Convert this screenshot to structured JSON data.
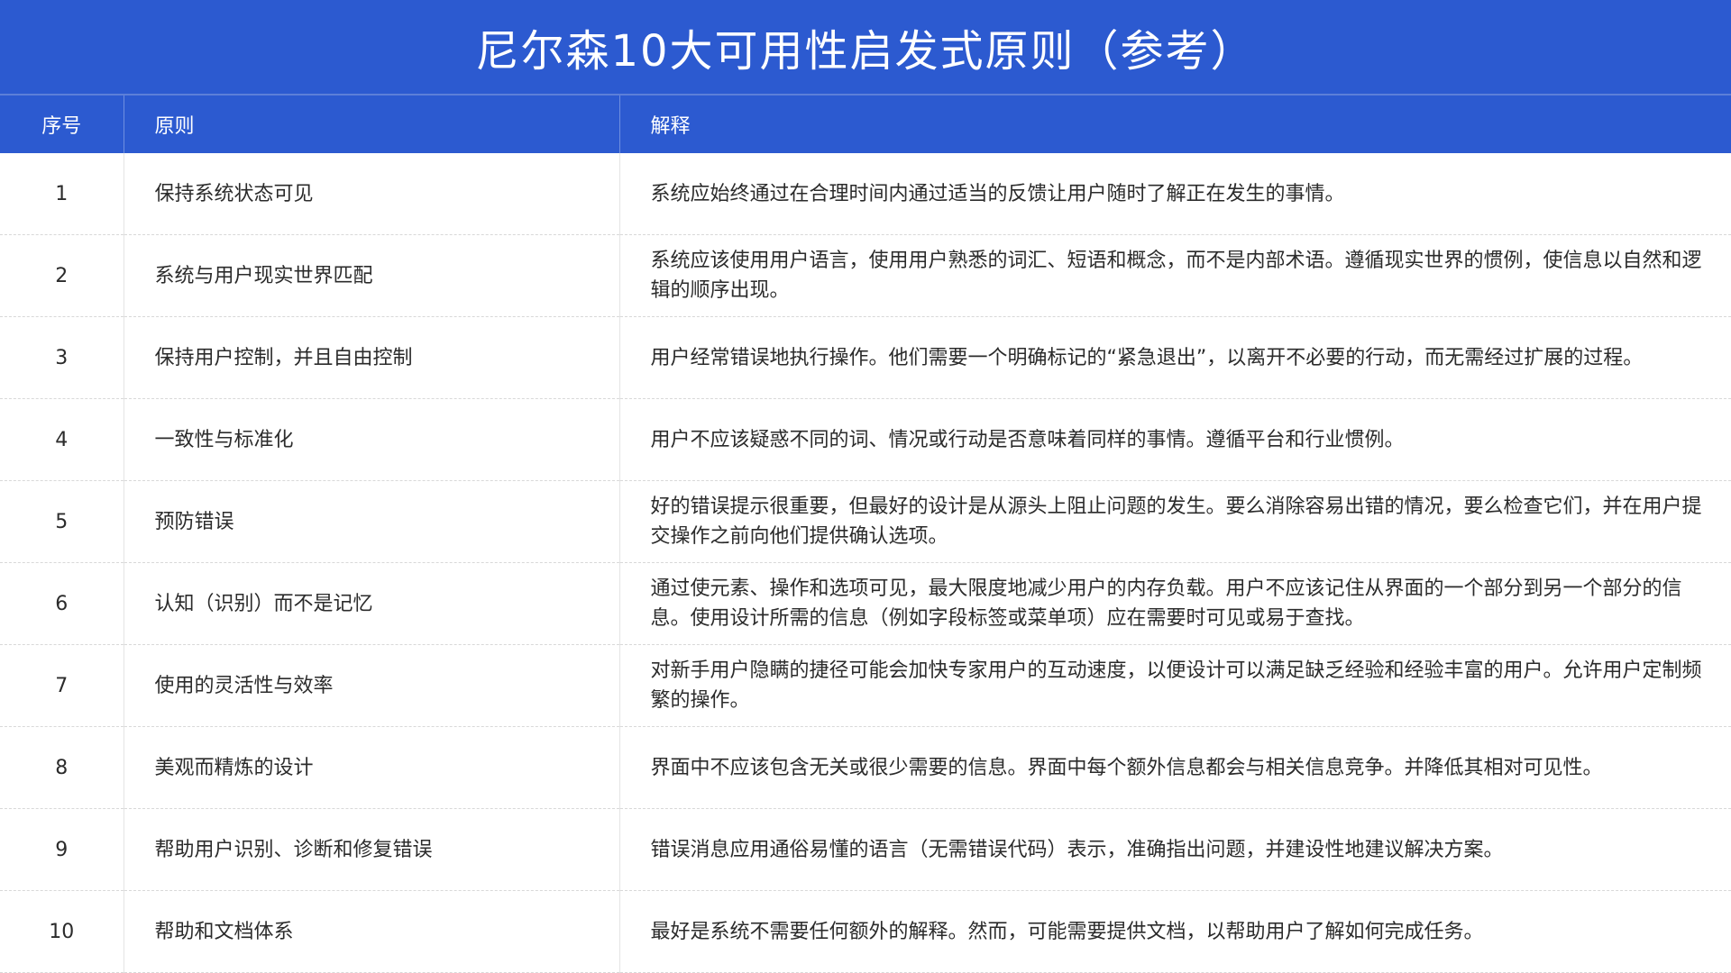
{
  "title": "尼尔森10大可用性启发式原则（参考）",
  "headers": {
    "num": "序号",
    "principle": "原则",
    "explanation": "解释"
  },
  "rows": [
    {
      "num": "1",
      "principle": "保持系统状态可见",
      "explanation": "系统应始终通过在合理时间内通过适当的反馈让用户随时了解正在发生的事情。"
    },
    {
      "num": "2",
      "principle": "系统与用户现实世界匹配",
      "explanation": "系统应该使用用户语言，使用用户熟悉的词汇、短语和概念，而不是内部术语。遵循现实世界的惯例，使信息以自然和逻辑的顺序出现。"
    },
    {
      "num": "3",
      "principle": "保持用户控制，并且自由控制",
      "explanation": "用户经常错误地执行操作。他们需要一个明确标记的“紧急退出”，以离开不必要的行动，而无需经过扩展的过程。"
    },
    {
      "num": "4",
      "principle": "一致性与标准化",
      "explanation": "用户不应该疑惑不同的词、情况或行动是否意味着同样的事情。遵循平台和行业惯例。"
    },
    {
      "num": "5",
      "principle": "预防错误",
      "explanation": "好的错误提示很重要，但最好的设计是从源头上阻止问题的发生。要么消除容易出错的情况，要么检查它们，并在用户提交操作之前向他们提供确认选项。"
    },
    {
      "num": "6",
      "principle": "认知（识别）而不是记忆",
      "explanation": "通过使元素、操作和选项可见，最大限度地减少用户的内存负载。用户不应该记住从界面的一个部分到另一个部分的信息。使用设计所需的信息（例如字段标签或菜单项）应在需要时可见或易于查找。"
    },
    {
      "num": "7",
      "principle": "使用的灵活性与效率",
      "explanation": "对新手用户隐瞒的捷径可能会加快专家用户的互动速度，以便设计可以满足缺乏经验和经验丰富的用户。允许用户定制频繁的操作。"
    },
    {
      "num": "8",
      "principle": "美观而精炼的设计",
      "explanation": "界面中不应该包含无关或很少需要的信息。界面中每个额外信息都会与相关信息竞争。并降低其相对可见性。"
    },
    {
      "num": "9",
      "principle": "帮助用户识别、诊断和修复错误",
      "explanation": "错误消息应用通俗易懂的语言（无需错误代码）表示，准确指出问题，并建设性地建议解决方案。"
    },
    {
      "num": "10",
      "principle": "帮助和文档体系",
      "explanation": "最好是系统不需要任何额外的解释。然而，可能需要提供文档，以帮助用户了解如何完成任务。"
    }
  ]
}
